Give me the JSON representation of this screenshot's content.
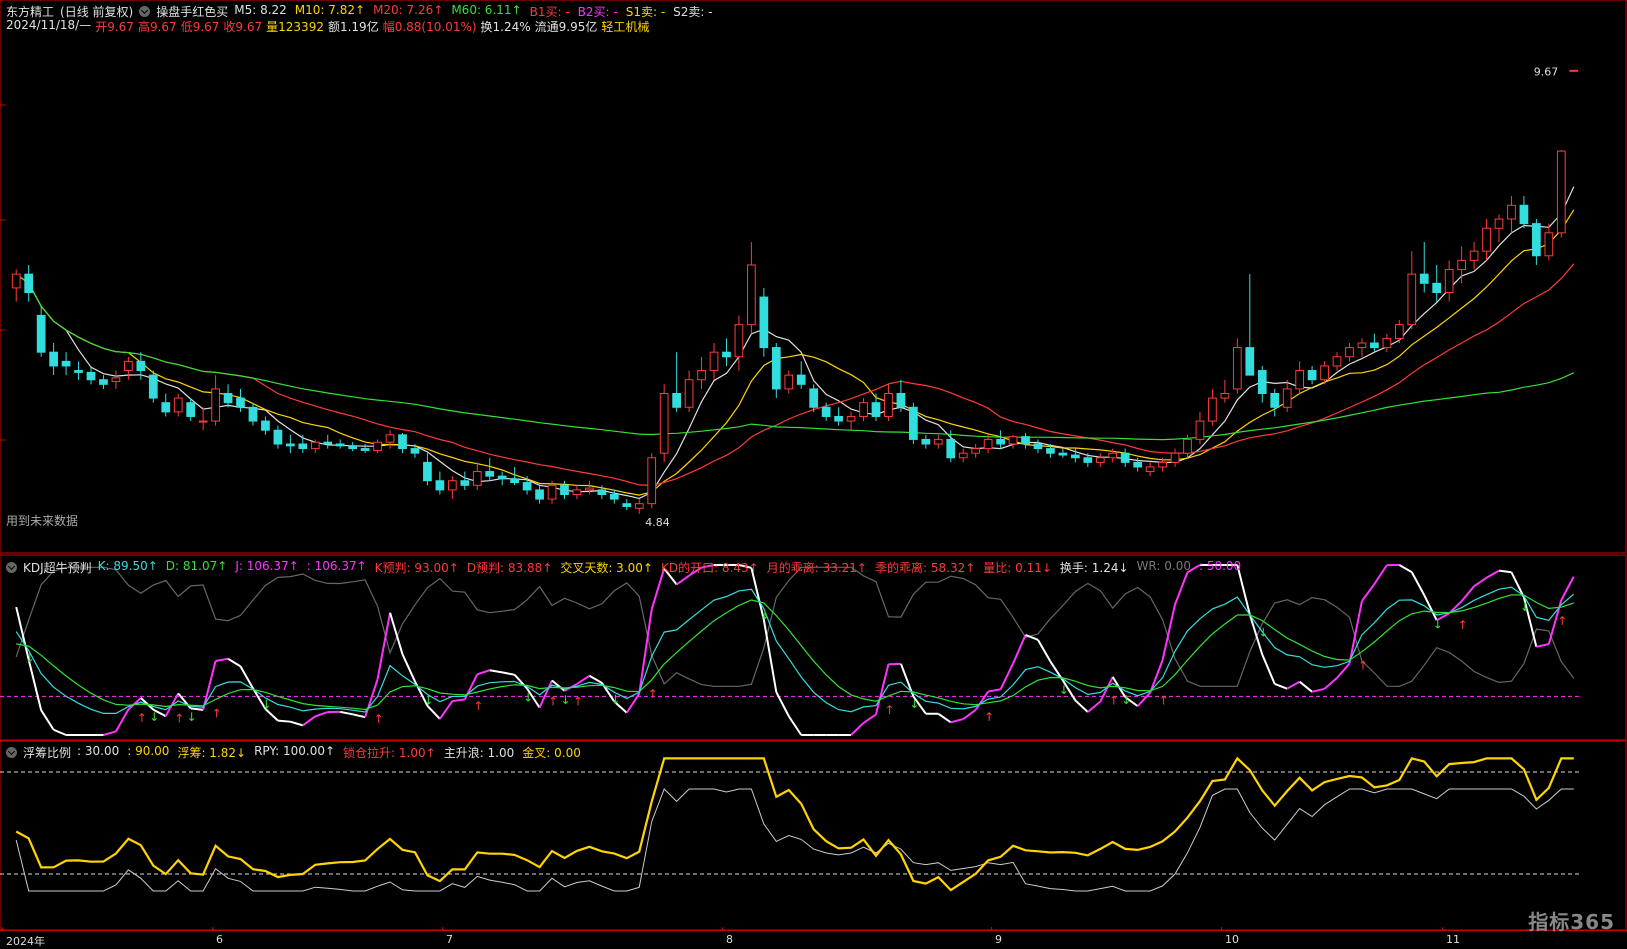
{
  "header": {
    "stock": "东方精工",
    "period": "(日线 前复权)",
    "formula": "操盘手红色买",
    "ma": [
      {
        "label": "M5: 8.22",
        "color": "#e0e0e0"
      },
      {
        "label": "M10: 7.82↑",
        "color": "#ffd400"
      },
      {
        "label": "M20: 7.26↑",
        "color": "#ff3a3a"
      },
      {
        "label": "M60: 6.11↑",
        "color": "#35e035"
      },
      {
        "label": "B1买: -",
        "color": "#ff3a3a"
      },
      {
        "label": "B2买: -",
        "color": "#ff33ff"
      },
      {
        "label": "S1卖: -",
        "color": "#ffd400"
      },
      {
        "label": "S2卖: -",
        "color": "#e0e0e0"
      }
    ],
    "info_parts": [
      {
        "text": "2024/11/18/—",
        "color": "#e0e0e0"
      },
      {
        "text": "开9.67",
        "color": "#ff3a3a"
      },
      {
        "text": "高9.67",
        "color": "#ff3a3a"
      },
      {
        "text": "低9.67",
        "color": "#ff3a3a"
      },
      {
        "text": "收9.67",
        "color": "#ff3a3a"
      },
      {
        "text": "量123392",
        "color": "#ffd400"
      },
      {
        "text": "额1.19亿",
        "color": "#e0e0e0"
      },
      {
        "text": "幅0.88(10.01%)",
        "color": "#ff3a3a"
      },
      {
        "text": "换1.24%",
        "color": "#e0e0e0"
      },
      {
        "text": "流通9.95亿",
        "color": "#e0e0e0"
      },
      {
        "text": "轻工机械",
        "color": "#ffd400"
      }
    ],
    "future_note": "用到未来数据"
  },
  "kdj_panel": {
    "title": "KDJ超牛预判",
    "items": [
      {
        "text": "K: 89.50↑",
        "color": "#33dddd"
      },
      {
        "text": "D: 81.07↑",
        "color": "#35e035"
      },
      {
        "text": "J: 106.37↑",
        "color": "#ff33ff"
      },
      {
        "text": ": 106.37↑",
        "color": "#ff33ff"
      },
      {
        "text": "K预判: 93.00↑",
        "color": "#ff3a3a"
      },
      {
        "text": "D预判: 83.88↑",
        "color": "#ff3a3a"
      },
      {
        "text": "交叉天数: 3.00↑",
        "color": "#ffd400"
      },
      {
        "text": "KD的开口: 8.43↑",
        "color": "#ff3a3a"
      },
      {
        "text": "月的乖离: 33.21↑",
        "color": "#ff3a3a"
      },
      {
        "text": "季的乖离: 58.32↑",
        "color": "#ff3a3a"
      },
      {
        "text": "量比: 0.11↓",
        "color": "#ff3a3a"
      },
      {
        "text": "换手: 1.24↓",
        "color": "#e0e0e0"
      },
      {
        "text": "WR: 0.00",
        "color": "#777777"
      },
      {
        "text": ": 50.00",
        "color": "#ff33ff"
      }
    ]
  },
  "chip_panel": {
    "title": "浮筹比例",
    "items": [
      {
        "text": ": 30.00",
        "color": "#e0e0e0"
      },
      {
        "text": ": 90.00",
        "color": "#ffd400"
      },
      {
        "text": "浮筹: 1.82↓",
        "color": "#ffd400"
      },
      {
        "text": "RPY: 100.00↑",
        "color": "#e0e0e0"
      },
      {
        "text": "锁仓拉升: 1.00↑",
        "color": "#ff3a3a"
      },
      {
        "text": "主升浪: 1.00",
        "color": "#e0e0e0"
      },
      {
        "text": "金叉: 0.00",
        "color": "#ffd400"
      }
    ]
  },
  "axis": {
    "labels": [
      "2024年",
      "6",
      "7",
      "8",
      "9",
      "10",
      "11"
    ]
  },
  "brand": "指标365",
  "chart_data": {
    "type": "candlestick",
    "colors": {
      "up": "#ff3a3a",
      "down": "#33dddd",
      "ma5": "#e0e0e0",
      "ma10": "#ffd400",
      "ma20": "#ff3a3a",
      "ma60": "#35e035"
    },
    "price_range": [
      4.5,
      10.0
    ],
    "candles": [
      [
        7.3,
        7.5,
        7.15,
        7.45
      ],
      [
        7.45,
        7.55,
        7.15,
        7.25
      ],
      [
        7.0,
        7.1,
        6.55,
        6.6
      ],
      [
        6.6,
        6.7,
        6.35,
        6.45
      ],
      [
        6.5,
        6.6,
        6.35,
        6.45
      ],
      [
        6.4,
        6.5,
        6.3,
        6.38
      ],
      [
        6.38,
        6.45,
        6.25,
        6.3
      ],
      [
        6.3,
        6.35,
        6.2,
        6.25
      ],
      [
        6.28,
        6.4,
        6.2,
        6.32
      ],
      [
        6.4,
        6.55,
        6.3,
        6.5
      ],
      [
        6.5,
        6.6,
        6.3,
        6.4
      ],
      [
        6.35,
        6.4,
        6.05,
        6.1
      ],
      [
        6.05,
        6.15,
        5.9,
        5.95
      ],
      [
        5.95,
        6.15,
        5.9,
        6.1
      ],
      [
        6.05,
        6.1,
        5.85,
        5.9
      ],
      [
        5.85,
        6.0,
        5.75,
        5.85
      ],
      [
        5.85,
        6.35,
        5.8,
        6.2
      ],
      [
        6.15,
        6.25,
        6.0,
        6.05
      ],
      [
        6.1,
        6.2,
        5.95,
        6.0
      ],
      [
        6.0,
        6.05,
        5.8,
        5.85
      ],
      [
        5.85,
        5.9,
        5.7,
        5.75
      ],
      [
        5.75,
        5.8,
        5.55,
        5.6
      ],
      [
        5.6,
        5.7,
        5.5,
        5.58
      ],
      [
        5.6,
        5.7,
        5.5,
        5.55
      ],
      [
        5.55,
        5.65,
        5.5,
        5.62
      ],
      [
        5.62,
        5.7,
        5.55,
        5.6
      ],
      [
        5.6,
        5.65,
        5.55,
        5.58
      ],
      [
        5.58,
        5.62,
        5.52,
        5.55
      ],
      [
        5.55,
        5.6,
        5.5,
        5.53
      ],
      [
        5.53,
        5.65,
        5.5,
        5.62
      ],
      [
        5.62,
        5.75,
        5.55,
        5.7
      ],
      [
        5.7,
        5.72,
        5.5,
        5.55
      ],
      [
        5.55,
        5.6,
        5.45,
        5.5
      ],
      [
        5.4,
        5.5,
        5.15,
        5.2
      ],
      [
        5.2,
        5.3,
        5.05,
        5.1
      ],
      [
        5.1,
        5.25,
        5.0,
        5.2
      ],
      [
        5.2,
        5.3,
        5.1,
        5.15
      ],
      [
        5.15,
        5.4,
        5.1,
        5.3
      ],
      [
        5.3,
        5.45,
        5.2,
        5.25
      ],
      [
        5.25,
        5.3,
        5.15,
        5.22
      ],
      [
        5.22,
        5.35,
        5.15,
        5.18
      ],
      [
        5.18,
        5.25,
        5.05,
        5.1
      ],
      [
        5.1,
        5.15,
        4.95,
        5.0
      ],
      [
        5.0,
        5.2,
        4.95,
        5.15
      ],
      [
        5.15,
        5.2,
        5.0,
        5.05
      ],
      [
        5.05,
        5.15,
        5.0,
        5.1
      ],
      [
        5.1,
        5.2,
        5.05,
        5.12
      ],
      [
        5.1,
        5.15,
        5.0,
        5.05
      ],
      [
        5.05,
        5.1,
        4.95,
        5.0
      ],
      [
        4.95,
        5.0,
        4.88,
        4.92
      ],
      [
        4.9,
        5.0,
        4.84,
        4.95
      ],
      [
        4.95,
        5.5,
        4.9,
        5.45
      ],
      [
        5.5,
        6.25,
        5.4,
        6.15
      ],
      [
        6.15,
        6.6,
        5.95,
        6.0
      ],
      [
        6.0,
        6.4,
        5.95,
        6.3
      ],
      [
        6.3,
        6.55,
        6.2,
        6.4
      ],
      [
        6.4,
        6.7,
        6.3,
        6.6
      ],
      [
        6.6,
        6.75,
        6.45,
        6.55
      ],
      [
        6.55,
        7.0,
        6.4,
        6.9
      ],
      [
        6.9,
        7.8,
        6.8,
        7.55
      ],
      [
        7.2,
        7.3,
        6.55,
        6.65
      ],
      [
        6.65,
        6.7,
        6.1,
        6.2
      ],
      [
        6.2,
        6.4,
        6.15,
        6.35
      ],
      [
        6.35,
        6.5,
        6.2,
        6.25
      ],
      [
        6.2,
        6.25,
        5.95,
        6.0
      ],
      [
        6.0,
        6.05,
        5.85,
        5.9
      ],
      [
        5.9,
        6.0,
        5.8,
        5.85
      ],
      [
        5.85,
        5.95,
        5.75,
        5.9
      ],
      [
        5.9,
        6.1,
        5.85,
        6.05
      ],
      [
        6.05,
        6.15,
        5.85,
        5.9
      ],
      [
        5.9,
        6.25,
        5.85,
        6.15
      ],
      [
        6.15,
        6.3,
        5.95,
        6.0
      ],
      [
        6.0,
        6.05,
        5.6,
        5.65
      ],
      [
        5.65,
        5.7,
        5.55,
        5.6
      ],
      [
        5.6,
        5.7,
        5.55,
        5.65
      ],
      [
        5.65,
        5.75,
        5.4,
        5.45
      ],
      [
        5.45,
        5.55,
        5.4,
        5.5
      ],
      [
        5.5,
        5.6,
        5.45,
        5.55
      ],
      [
        5.55,
        5.7,
        5.5,
        5.65
      ],
      [
        5.65,
        5.75,
        5.55,
        5.6
      ],
      [
        5.6,
        5.7,
        5.55,
        5.68
      ],
      [
        5.68,
        5.72,
        5.55,
        5.6
      ],
      [
        5.6,
        5.65,
        5.5,
        5.55
      ],
      [
        5.55,
        5.6,
        5.45,
        5.5
      ],
      [
        5.5,
        5.55,
        5.45,
        5.48
      ],
      [
        5.48,
        5.55,
        5.4,
        5.45
      ],
      [
        5.45,
        5.5,
        5.35,
        5.4
      ],
      [
        5.4,
        5.5,
        5.35,
        5.45
      ],
      [
        5.45,
        5.55,
        5.4,
        5.5
      ],
      [
        5.5,
        5.55,
        5.35,
        5.4
      ],
      [
        5.4,
        5.45,
        5.3,
        5.35
      ],
      [
        5.3,
        5.4,
        5.25,
        5.35
      ],
      [
        5.35,
        5.45,
        5.3,
        5.4
      ],
      [
        5.4,
        5.55,
        5.35,
        5.5
      ],
      [
        5.5,
        5.7,
        5.45,
        5.65
      ],
      [
        5.65,
        5.95,
        5.6,
        5.85
      ],
      [
        5.85,
        6.2,
        5.8,
        6.1
      ],
      [
        6.1,
        6.3,
        6.05,
        6.15
      ],
      [
        6.2,
        6.75,
        6.15,
        6.65
      ],
      [
        6.65,
        7.45,
        6.6,
        6.35
      ],
      [
        6.4,
        6.45,
        6.05,
        6.15
      ],
      [
        6.15,
        6.2,
        5.9,
        6.0
      ],
      [
        6.0,
        6.3,
        5.95,
        6.2
      ],
      [
        6.2,
        6.5,
        6.15,
        6.4
      ],
      [
        6.4,
        6.45,
        6.25,
        6.3
      ],
      [
        6.3,
        6.5,
        6.25,
        6.45
      ],
      [
        6.45,
        6.6,
        6.4,
        6.55
      ],
      [
        6.55,
        6.7,
        6.5,
        6.65
      ],
      [
        6.65,
        6.75,
        6.55,
        6.7
      ],
      [
        6.7,
        6.8,
        6.6,
        6.65
      ],
      [
        6.65,
        6.8,
        6.6,
        6.75
      ],
      [
        6.75,
        6.95,
        6.7,
        6.9
      ],
      [
        6.9,
        7.7,
        6.85,
        7.45
      ],
      [
        7.45,
        7.8,
        7.25,
        7.35
      ],
      [
        7.35,
        7.55,
        7.15,
        7.25
      ],
      [
        7.25,
        7.6,
        7.15,
        7.5
      ],
      [
        7.5,
        7.75,
        7.35,
        7.6
      ],
      [
        7.6,
        7.8,
        7.5,
        7.7
      ],
      [
        7.7,
        8.05,
        7.6,
        7.95
      ],
      [
        7.95,
        8.1,
        7.8,
        8.05
      ],
      [
        8.05,
        8.3,
        7.9,
        8.2
      ],
      [
        8.2,
        8.3,
        7.95,
        8.0
      ],
      [
        8.0,
        8.05,
        7.55,
        7.65
      ],
      [
        7.65,
        8.0,
        7.6,
        7.9
      ],
      [
        7.9,
        8.8,
        7.85,
        8.79
      ],
      [
        9.67,
        9.67,
        9.67,
        9.67
      ]
    ]
  }
}
